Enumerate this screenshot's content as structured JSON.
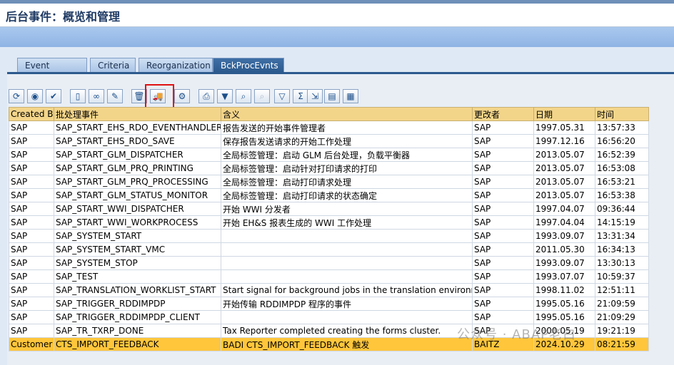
{
  "window": {
    "title": "后台事件：概览和管理"
  },
  "tabs": [
    {
      "label": "Event History",
      "active": false
    },
    {
      "label": "Criteria",
      "active": false
    },
    {
      "label": "Reorganization",
      "active": false
    },
    {
      "label": "BckProcEvnts",
      "active": true
    }
  ],
  "toolbar": {
    "icons": [
      "refresh-icon",
      "details-icon",
      "check-icon",
      "new-icon",
      "change-icon",
      "edit-icon",
      "delete-icon",
      "transport-icon",
      "where-used-icon",
      "print-icon",
      "filter-icon",
      "find-icon",
      "find-next-icon",
      "set-filter-icon",
      "sum-icon",
      "export-icon",
      "layout-icon",
      "grid-icon"
    ]
  },
  "table": {
    "headers": [
      "Created By",
      "批处理事件",
      "含义",
      "更改者",
      "日期",
      "时间"
    ],
    "rows": [
      [
        "SAP",
        "SAP_START_EHS_RDO_EVENTHANDLER",
        "报告发送的开始事件管理者",
        "SAP",
        "1997.05.31",
        "13:57:33"
      ],
      [
        "SAP",
        "SAP_START_EHS_RDO_SAVE",
        "保存报告发送请求的开始工作处理",
        "SAP",
        "1997.12.16",
        "16:56:20"
      ],
      [
        "SAP",
        "SAP_START_GLM_DISPATCHER",
        "全局标签管理：启动 GLM 后台处理，负载平衡器",
        "SAP",
        "2013.05.07",
        "16:52:39"
      ],
      [
        "SAP",
        "SAP_START_GLM_PRQ_PRINTING",
        "全局标签管理：启动针对打印请求的打印",
        "SAP",
        "2013.05.07",
        "16:53:08"
      ],
      [
        "SAP",
        "SAP_START_GLM_PRQ_PROCESSING",
        "全局标签管理：启动打印请求处理",
        "SAP",
        "2013.05.07",
        "16:53:21"
      ],
      [
        "SAP",
        "SAP_START_GLM_STATUS_MONITOR",
        "全局标签管理：启动打印请求的状态确定",
        "SAP",
        "2013.05.07",
        "16:53:38"
      ],
      [
        "SAP",
        "SAP_START_WWI_DISPATCHER",
        "开始 WWI 分发者",
        "SAP",
        "1997.04.07",
        "09:36:44"
      ],
      [
        "SAP",
        "SAP_START_WWI_WORKPROCESS",
        "开始 EH&S 报表生成的 WWI 工作处理",
        "SAP",
        "1997.04.04",
        "14:15:19"
      ],
      [
        "SAP",
        "SAP_SYSTEM_START",
        "",
        "SAP",
        "1993.09.07",
        "13:31:34"
      ],
      [
        "SAP",
        "SAP_SYSTEM_START_VMC",
        "",
        "SAP",
        "2011.05.30",
        "16:34:13"
      ],
      [
        "SAP",
        "SAP_SYSTEM_STOP",
        "",
        "SAP",
        "1993.09.07",
        "13:30:13"
      ],
      [
        "SAP",
        "SAP_TEST",
        "",
        "SAP",
        "1993.07.07",
        "10:59:37"
      ],
      [
        "SAP",
        "SAP_TRANSLATION_WORKLIST_START",
        "Start signal for background jobs in the translation environment",
        "SAP",
        "1998.11.02",
        "12:51:11"
      ],
      [
        "SAP",
        "SAP_TRIGGER_RDDIMPDP",
        "开始传输 RDDIMPDP 程序的事件",
        "SAP",
        "1995.05.16",
        "21:09:59"
      ],
      [
        "SAP",
        "SAP_TRIGGER_RDDIMPDP_CLIENT",
        "",
        "SAP",
        "1995.05.16",
        "21:09:29"
      ],
      [
        "SAP",
        "SAP_TR_TXRP_DONE",
        "Tax Reporter completed creating the forms cluster.",
        "SAP",
        "2000.05.19",
        "19:21:19"
      ],
      [
        "Customer",
        "CTS_IMPORT_FEEDBACK",
        "BADI CTS_IMPORT_FEEDBACK 触发",
        "BAITZ",
        "2024.10.29",
        "08:21:59"
      ]
    ],
    "selected_row": 16
  },
  "watermark": "公众号 · ABAP老白"
}
